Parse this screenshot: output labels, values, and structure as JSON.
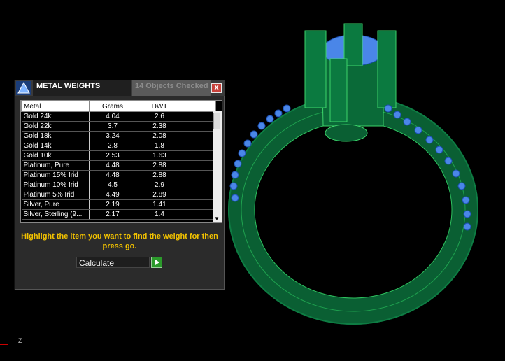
{
  "panel": {
    "title": "METAL WEIGHTS",
    "status_tab": "14 Objects Checked",
    "close_label": "x",
    "columns": [
      "Metal",
      "Grams",
      "DWT",
      ""
    ],
    "rows": [
      {
        "metal": "Gold 24k",
        "grams": "4.04",
        "dwt": "2.6"
      },
      {
        "metal": "Gold 22k",
        "grams": "3.7",
        "dwt": "2.38"
      },
      {
        "metal": "Gold 18k",
        "grams": "3.24",
        "dwt": "2.08"
      },
      {
        "metal": "Gold 14k",
        "grams": "2.8",
        "dwt": "1.8"
      },
      {
        "metal": "Gold 10k",
        "grams": "2.53",
        "dwt": "1.63"
      },
      {
        "metal": "Platinum, Pure",
        "grams": "4.48",
        "dwt": "2.88"
      },
      {
        "metal": "Platinum 15% Irid",
        "grams": "4.48",
        "dwt": "2.88"
      },
      {
        "metal": "Platinum 10% Irid",
        "grams": "4.5",
        "dwt": "2.9"
      },
      {
        "metal": "Platinum 5% Irid",
        "grams": "4.49",
        "dwt": "2.89"
      },
      {
        "metal": "Silver, Pure",
        "grams": "2.19",
        "dwt": "1.41"
      },
      {
        "metal": "Silver, Sterling (9...",
        "grams": "2.17",
        "dwt": "1.4"
      }
    ],
    "instruction": "Highlight the item you want to find the weight for then press go.",
    "action_select": "Calculate"
  },
  "viewport": {
    "axis_label": "Z"
  },
  "colors": {
    "ring_green": "#0b6b3a",
    "wire_green": "#3cd46a",
    "gem_blue": "#4a86e8",
    "accent_yellow": "#f2c200"
  }
}
